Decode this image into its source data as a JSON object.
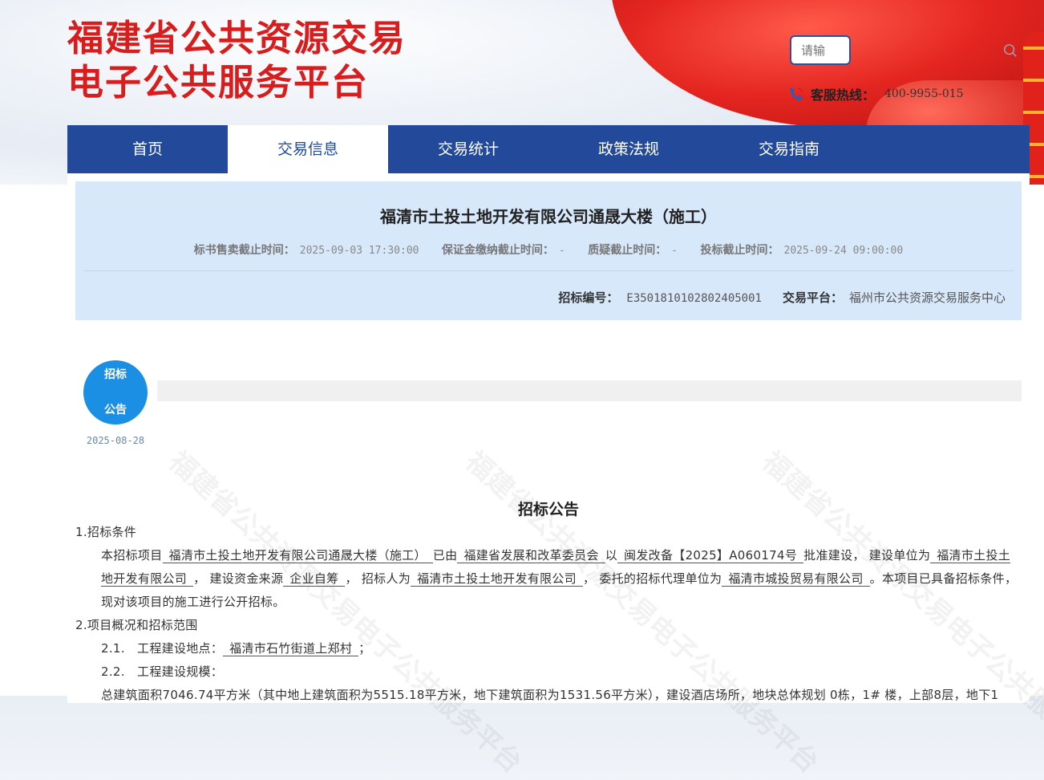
{
  "header": {
    "site_title_line1": "福建省公共资源交易",
    "site_title_line2": "电子公共服务平台",
    "search_placeholder": "请输",
    "hotline_label": "客服热线：",
    "hotline_number": "400-9955-015"
  },
  "nav": {
    "items": [
      "首页",
      "交易信息",
      "交易统计",
      "政策法规",
      "交易指南"
    ],
    "active_index": 1
  },
  "project": {
    "title": "福清市土投土地开发有限公司通晟大楼（施工）",
    "deadlines": [
      {
        "label": "标书售卖截止时间：",
        "value": "2025-09-03 17:30:00"
      },
      {
        "label": "保证金缴纳截止时间：",
        "value": "-"
      },
      {
        "label": "质疑截止时间：",
        "value": "-"
      },
      {
        "label": "投标截止时间：",
        "value": "2025-09-24 09:00:00"
      }
    ],
    "bid_no_label": "招标编号：",
    "bid_no": "E3501810102802405001",
    "platform_label": "交易平台：",
    "platform": "福州市公共资源交易服务中心"
  },
  "timeline": {
    "stage_line1": "招标",
    "stage_line2": "公告",
    "stage_date": "2025-08-28"
  },
  "notice": {
    "title": "招标公告",
    "sec1_title": "1.招标条件",
    "p1_a": "本招标项目",
    "p1_project": "福清市土投土地开发有限公司通晟大楼（施工）",
    "p1_b": "已由",
    "p1_approver": "福建省发展和改革委员会",
    "p1_c": "以",
    "p1_doc": "闽发改备【2025】A060174号",
    "p1_d": "批准建设，  建设单位为",
    "p1_builder": "福清市土投土地开发有限公司",
    "p1_e": "，  建设资金来源",
    "p1_fund": "企业自筹",
    "p1_f": "，  招标人为",
    "p1_tenderer": "福清市土投土地开发有限公司",
    "p1_g": "，  委托的招标代理单位为",
    "p1_agent": "福清市城投贸易有限公司",
    "p1_h": "。本项目已具备招标条件，现对该项目的施工进行公开招标。",
    "sec2_title": "2.项目概况和招标范围",
    "item21_no": "2.1.",
    "item21_label": "工程建设地点：",
    "item21_value": "福清市石竹街道上郑村",
    "item21_end": "；",
    "item22_no": "2.2.",
    "item22_label": "工程建设规模：",
    "item22_text": "总建筑面积7046.74平方米（其中地上建筑面积为5515.18平方米，地下建筑面积为1531.56平方米），建设酒店场所，地块总体规划 0栋，1# 楼，上部8层，地下1"
  },
  "watermark_text": "福建省公共资源交易电子公共服务平台"
}
